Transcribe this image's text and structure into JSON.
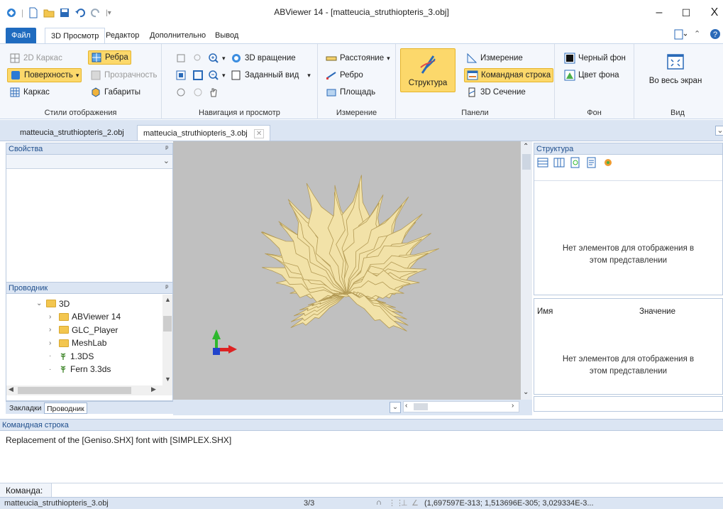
{
  "window": {
    "title": "ABViewer 14 - [matteucia_struthiopteris_3.obj]",
    "minimize": "–",
    "maximize": "☐",
    "close": "X"
  },
  "ribbon_tabs": [
    "Файл",
    "3D Просмотр",
    "Редактор",
    "Дополнительно",
    "Вывод"
  ],
  "ribbon": {
    "display_styles": {
      "label": "Стили отображения",
      "items": [
        "2D Каркас",
        "Ребра",
        "Поверхность",
        "Прозрачность",
        "Каркас",
        "Габариты"
      ]
    },
    "navigation": {
      "label": "Навигация и просмотр",
      "rotate": "3D вращение",
      "preset_view": "Заданный вид"
    },
    "measure": {
      "label": "Измерение",
      "items": [
        "Расстояние",
        "Ребро",
        "Площадь"
      ]
    },
    "panels": {
      "label": "Панели",
      "structure": "Структура",
      "items": [
        "Измерение",
        "Командная строка",
        "3D Сечение"
      ]
    },
    "background": {
      "label": "Фон",
      "items": [
        "Черный фон",
        "Цвет фона"
      ]
    },
    "view": {
      "label": "Вид",
      "fullscreen": "Во весь экран"
    }
  },
  "doc_tabs": [
    "matteucia_struthiopteris_2.obj",
    "matteucia_struthiopteris_3.obj"
  ],
  "properties_panel": {
    "title": "Свойства"
  },
  "explorer_panel": {
    "title": "Проводник",
    "tree": [
      {
        "label": "3D",
        "level": 0,
        "kind": "folder",
        "twisty": "open"
      },
      {
        "label": "ABViewer 14",
        "level": 1,
        "kind": "folder",
        "twisty": "closed"
      },
      {
        "label": "GLC_Player",
        "level": 1,
        "kind": "folder",
        "twisty": "closed"
      },
      {
        "label": "MeshLab",
        "level": 1,
        "kind": "folder",
        "twisty": "closed"
      },
      {
        "label": "1.3DS",
        "level": 1,
        "kind": "file",
        "twisty": "none"
      },
      {
        "label": "Fern 3.3ds",
        "level": 1,
        "kind": "file",
        "twisty": "none"
      }
    ]
  },
  "left_bottom_tabs": [
    "Закладки",
    "Проводник"
  ],
  "structure_panel": {
    "title": "Структура",
    "empty_line1": "Нет элементов для отображения в",
    "empty_line2": "этом представлении"
  },
  "property_table": {
    "col_name": "Имя",
    "col_value": "Значение",
    "empty_line1": "Нет элементов для отображения в",
    "empty_line2": "этом представлении"
  },
  "command_panel": {
    "title": "Командная строка",
    "output": "Replacement of the [Geniso.SHX] font with [SIMPLEX.SHX]",
    "prompt_label": "Команда:"
  },
  "status_bar": {
    "file": "matteucia_struthiopteris_3.obj",
    "page": "3/3",
    "coords": "(1,697597E-313; 1,513696E-305; 3,029334E-3..."
  },
  "colors": {
    "accent": "#1f6bbf",
    "highlight": "#fcd86b",
    "viewport_bg": "#c0c0c0",
    "model": "#f2e2a8"
  }
}
